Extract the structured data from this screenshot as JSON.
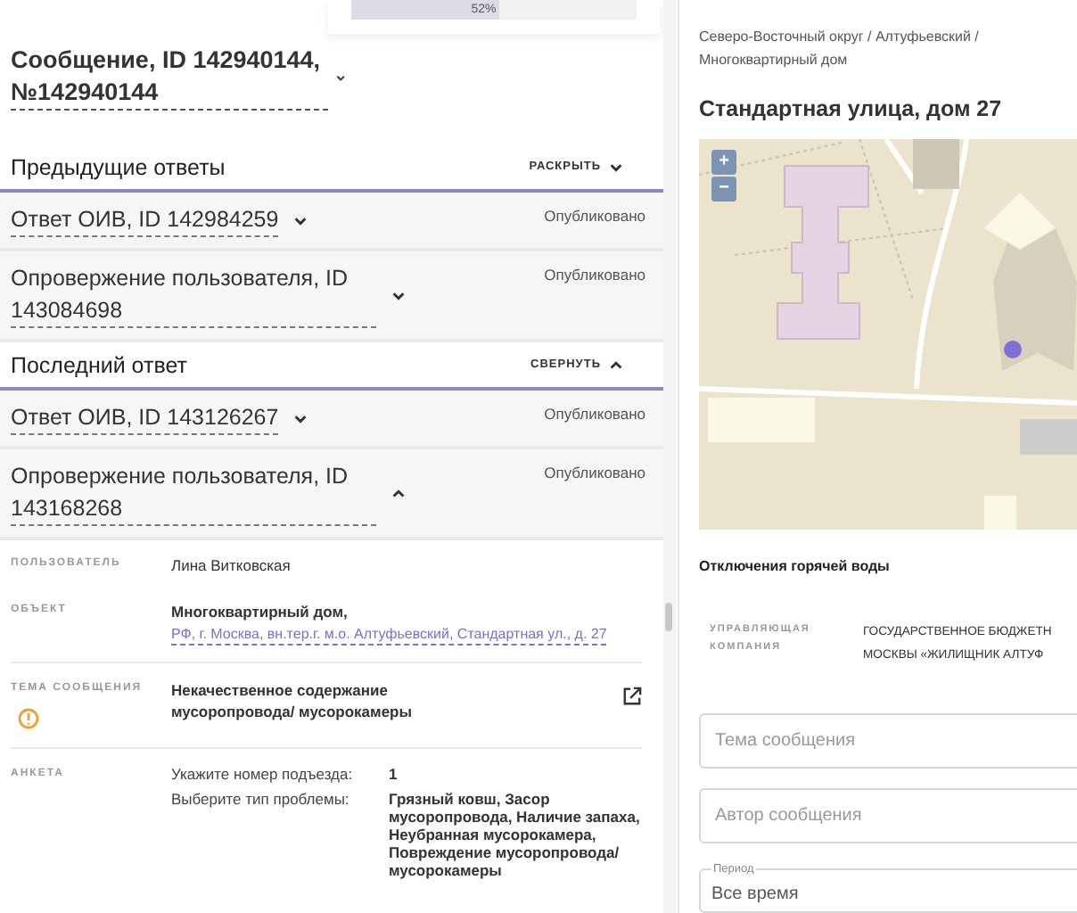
{
  "progress": {
    "label": "52%",
    "level": 0.52
  },
  "message": {
    "title": "Сообщение, ID 142940144, №142940144",
    "expanded": false
  },
  "response_sections": [
    {
      "title": "Предыдущие ответы",
      "toggle": "РАСКРЫТЬ",
      "expanded": false,
      "items": [
        {
          "title": "Ответ ОИВ, ID 142984259",
          "status": "Опубликовано",
          "expanded": false
        },
        {
          "title": "Опровержение пользователя, ID 143084698",
          "status": "Опубликовано",
          "expanded": false
        }
      ]
    },
    {
      "title": "Последний ответ",
      "toggle": "СВЕРНУТЬ",
      "expanded": true,
      "items": [
        {
          "title": "Ответ ОИВ, ID 143126267",
          "status": "Опубликовано",
          "expanded": false
        },
        {
          "title": "Опровержение пользователя, ID 143168268",
          "status": "Опубликовано",
          "expanded": true
        }
      ]
    }
  ],
  "details": [
    {
      "kind": "text",
      "label": "ПОЛЬЗОВАТЕЛЬ",
      "value": "Лина Витковская"
    },
    {
      "kind": "object",
      "label": "ОБЪЕКТ",
      "value": "Многоквартирный дом,",
      "link": "РФ, г. Москва, вн.тер.г. м.о. Алтуфьевский, Стандартная ул., д. 27"
    },
    {
      "kind": "topic",
      "label": "ТЕМА СООБЩЕНИЯ",
      "value": "Некачественное содержание мусоропровода/ мусорокамеры"
    },
    {
      "kind": "survey",
      "label": "АНКЕТА",
      "pairs": [
        {
          "question": "Укажите номер подъезда:",
          "answer": "1"
        },
        {
          "question": "Выберите тип проблемы:",
          "answer": "Грязный ковш, Засор мусоропровода, Наличие запаха, Неубранная мусорокамера, Повреждение мусоропровода/ мусорокамеры"
        }
      ]
    }
  ],
  "place": {
    "breadcrumb": "Северо-Восточный округ / Алтуфьевский / Многоквартирный дом",
    "title": "Стандартная улица, дом 27",
    "map": {
      "zoom_in": "+",
      "zoom_out": "−"
    },
    "outage": "Отключения горячей воды",
    "company": {
      "label": "УПРАВЛЯЮЩАЯ КОМПАНИЯ",
      "lines": [
        "ГОСУДАРСТВЕННОЕ БЮДЖЕТН",
        "МОСКВЫ «ЖИЛИЩНИК АЛТУФ"
      ]
    }
  },
  "filters": [
    {
      "kind": "input",
      "placeholder": "Тема сообщения"
    },
    {
      "kind": "input",
      "placeholder": "Автор сообщения"
    },
    {
      "kind": "period",
      "legend": "Период",
      "value": "Все время"
    }
  ]
}
